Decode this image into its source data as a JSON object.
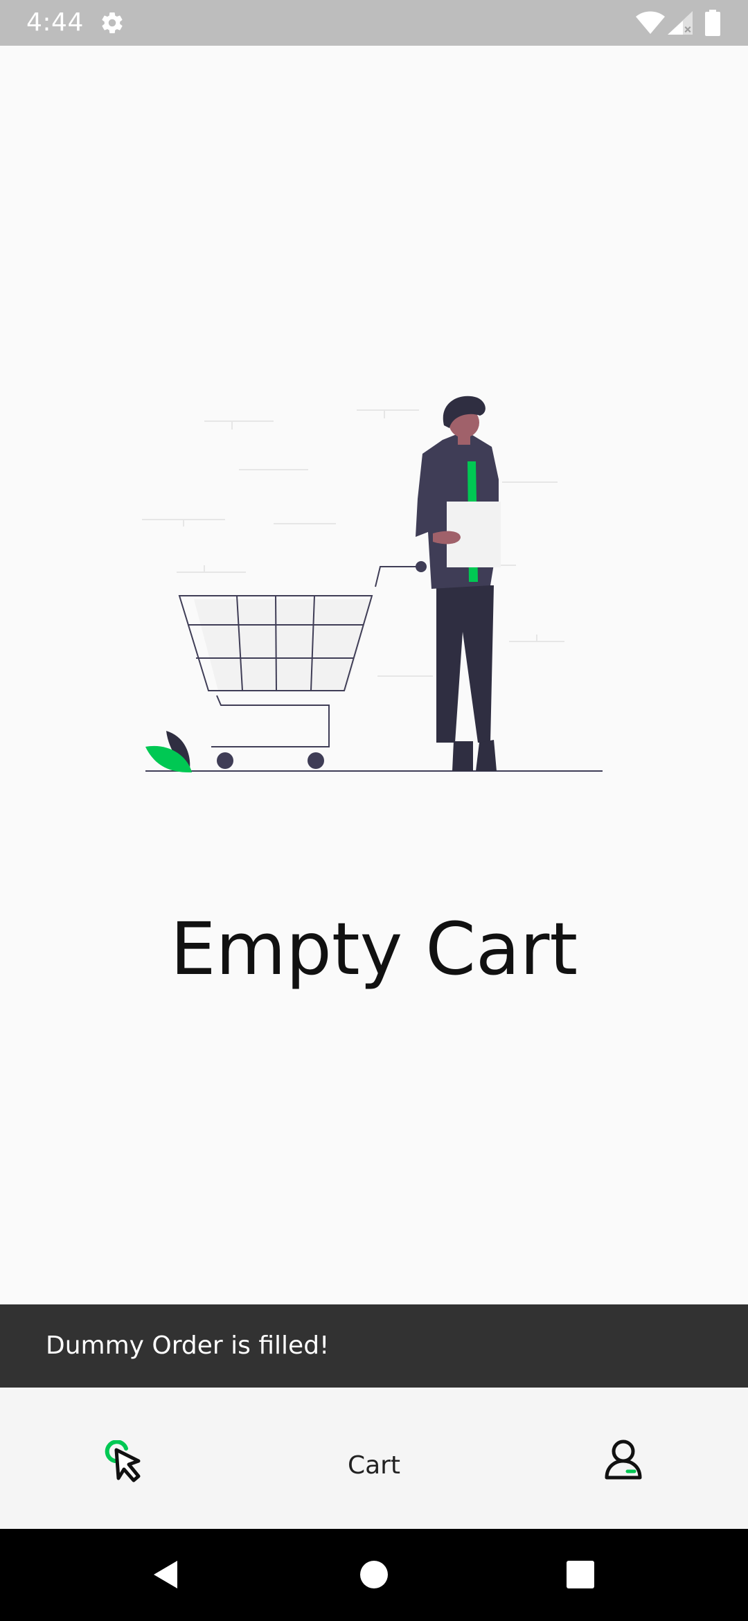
{
  "status_bar": {
    "time": "4:44",
    "icons": [
      "gear-icon",
      "wifi-icon",
      "cellular-signal-icon",
      "battery-icon"
    ]
  },
  "main": {
    "illustration": "empty-cart-illustration",
    "title": "Empty Cart"
  },
  "snackbar": {
    "message": "Dummy Order is filled!"
  },
  "bottom_nav": {
    "items": [
      {
        "icon": "cursor-click-icon"
      },
      {
        "label": "Cart"
      },
      {
        "icon": "user-icon"
      }
    ]
  },
  "system_nav": {
    "buttons": [
      "back-icon",
      "home-icon",
      "recents-icon"
    ]
  },
  "colors": {
    "accent": "#00c853",
    "dark": "#3f3d56",
    "snackbar_bg": "#323232",
    "status_bar_bg": "#bdbdbd",
    "nav_bg": "#f5f5f5"
  }
}
